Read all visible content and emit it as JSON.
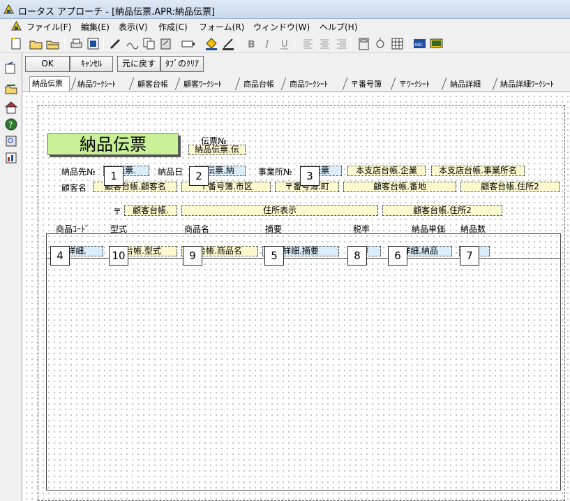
{
  "window": {
    "title": "ロータス アプローチ - [納品伝票.APR:納品伝票]"
  },
  "menu": [
    {
      "label": "ファイル(F)"
    },
    {
      "label": "編集(E)"
    },
    {
      "label": "表示(V)"
    },
    {
      "label": "作成(C)"
    },
    {
      "label": "フォーム(R)"
    },
    {
      "label": "ウィンドウ(W)"
    },
    {
      "label": "ヘルプ(H)"
    }
  ],
  "toolbar": {
    "icons": [
      "new-icon",
      "open-icon",
      "open-folder-icon",
      "print-icon",
      "print-preview-icon",
      "edit-pen-icon",
      "field-pen-icon",
      "copy-icon",
      "paste-icon",
      "button-tool-icon",
      "fill-color-icon",
      "line-color-icon",
      "bold-icon",
      "italic-icon",
      "underline-icon",
      "align-left-icon",
      "align-center-icon",
      "align-right-icon",
      "calculator-icon",
      "magic-icon",
      "grid-icon",
      "spellcheck-icon",
      "display-icon"
    ],
    "bold": "B",
    "italic": "I",
    "underline": "U",
    "spell": "ABC"
  },
  "buttons": {
    "ok": "OK",
    "cancel": "ｷｬﾝｾﾙ",
    "undo": "元に戻す",
    "clear": "ﾀﾌﾞのｸﾘｱ"
  },
  "tabs": [
    "納品伝票",
    "納品ﾜｰｸｼｰﾄ",
    "顧客台帳",
    "顧客ﾜｰｸｼｰﾄ",
    "商品台帳",
    "商品ﾜｰｸｼｰﾄ",
    "〒番号簿",
    "〒ﾜｰｸｼｰﾄ",
    "納品詳細",
    "納品詳細ﾜｰｸｼｰﾄ"
  ],
  "form": {
    "title": "納品伝票",
    "labels": {
      "slip_no": "伝票№",
      "delivery_to_no": "納品先№",
      "delivery_date": "納品日",
      "office_no": "事業所№",
      "customer_name": "顧客名",
      "postal_mark": "〒",
      "col_code": "商品ｺｰﾄﾞ",
      "col_model": "型式",
      "col_product": "商品名",
      "col_summary": "摘要",
      "col_tax": "税率",
      "col_unit_price": "納品単価",
      "col_qty": "納品数"
    },
    "fields": {
      "slip_no": "納品伝票.伝",
      "delivery_to_no": "伝票.",
      "delivery_date": "伝票.納",
      "office_no": "伝票",
      "company": "本支店台帳.企業",
      "office_name": "本支店台帳.事業所名",
      "customer_name": "顧客台帳.顧客名",
      "city": "〒番号簿.市区",
      "town": "〒番号簿.町",
      "street": "顧客台帳.番地",
      "address2": "顧客台帳.住所2",
      "postal": "顧客台帳.",
      "address_display": "住所表示",
      "address2b": "顧客台帳.住所2",
      "detail_code": "詳細.",
      "detail_model": "台帳.型式",
      "detail_product": "台帳.商品名",
      "detail_summary": "詳細.摘要",
      "detail_tax": "詳",
      "detail_unit_price": "詳細.納品",
      "detail_qty": "詳"
    },
    "tab_order": [
      "1",
      "2",
      "3",
      "4",
      "10",
      "9",
      "5",
      "8",
      "6",
      "7"
    ]
  }
}
